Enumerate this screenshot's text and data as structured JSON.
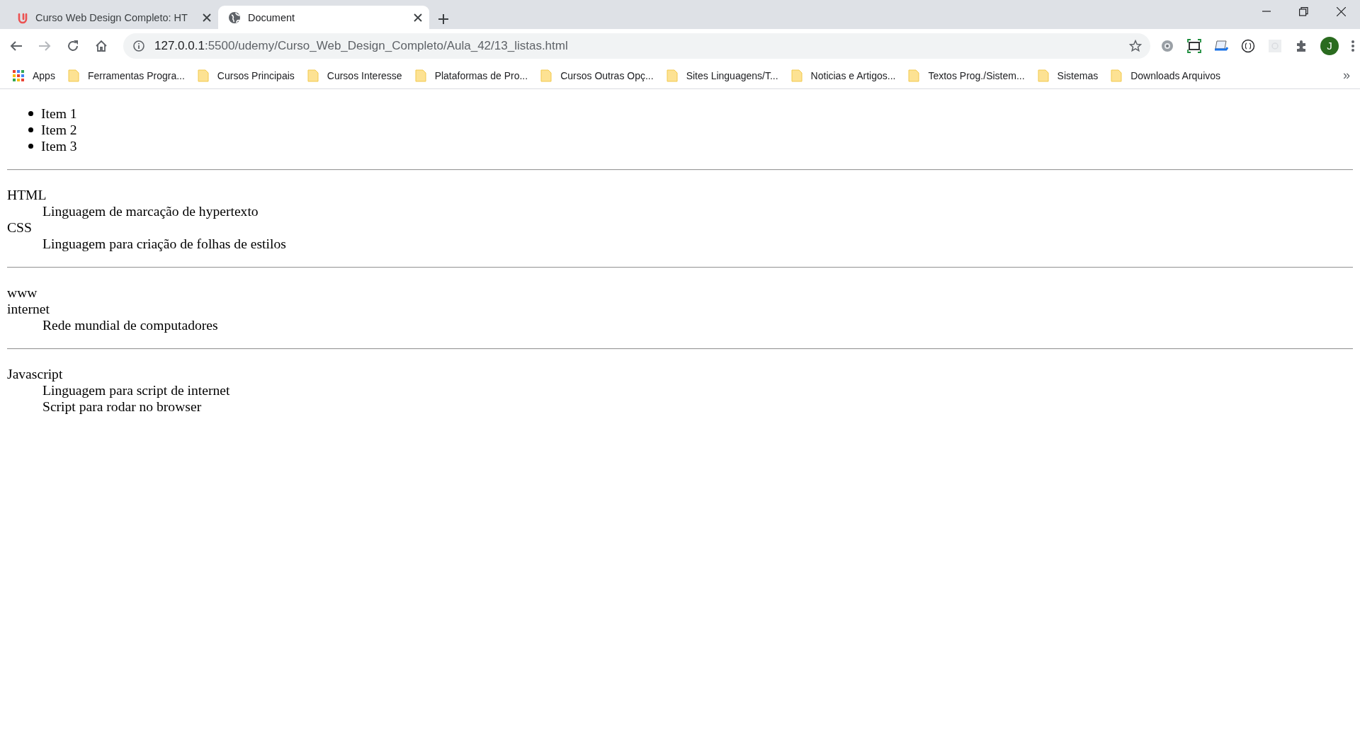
{
  "tabs": [
    {
      "title": "Curso Web Design Completo: HT",
      "kind": "udemy",
      "selected": false
    },
    {
      "title": "Document",
      "kind": "globe",
      "selected": true
    }
  ],
  "address": {
    "host": "127.0.0.1",
    "path": ":5500/udemy/Curso_Web_Design_Completo/Aula_42/13_listas.html"
  },
  "profile": {
    "initial": "J"
  },
  "bookmarks": [
    {
      "label": "Apps",
      "kind": "apps"
    },
    {
      "label": "Ferramentas Progra...",
      "kind": "folder"
    },
    {
      "label": "Cursos Principais",
      "kind": "folder"
    },
    {
      "label": "Cursos Interesse",
      "kind": "folder"
    },
    {
      "label": "Plataformas de Pro...",
      "kind": "folder"
    },
    {
      "label": "Cursos Outras Opç...",
      "kind": "folder"
    },
    {
      "label": "Sites Linguagens/T...",
      "kind": "folder"
    },
    {
      "label": "Noticias e Artigos...",
      "kind": "folder"
    },
    {
      "label": "Textos Prog./Sistem...",
      "kind": "folder"
    },
    {
      "label": "Sistemas",
      "kind": "folder"
    },
    {
      "label": "Downloads Arquivos",
      "kind": "folder"
    }
  ],
  "bookmarks_overflow": "»",
  "page": {
    "blocks": [
      {
        "kind": "bullets",
        "items": [
          "Item 1",
          "Item 2",
          "Item 3"
        ]
      },
      {
        "kind": "definitions",
        "entries": [
          {
            "kind": "term",
            "text": "HTML"
          },
          {
            "kind": "description",
            "text": "Linguagem de marcação de hypertexto"
          },
          {
            "kind": "term",
            "text": "CSS"
          },
          {
            "kind": "description",
            "text": "Linguagem para criação de folhas de estilos"
          }
        ]
      },
      {
        "kind": "definitions",
        "entries": [
          {
            "kind": "term",
            "text": "www"
          },
          {
            "kind": "term",
            "text": "internet"
          },
          {
            "kind": "description",
            "text": "Rede mundial de computadores"
          }
        ]
      },
      {
        "kind": "definitions",
        "entries": [
          {
            "kind": "term",
            "text": "Javascript"
          },
          {
            "kind": "description",
            "text": "Linguagem para script de internet"
          },
          {
            "kind": "description",
            "text": "Script para rodar no browser"
          }
        ]
      }
    ]
  }
}
